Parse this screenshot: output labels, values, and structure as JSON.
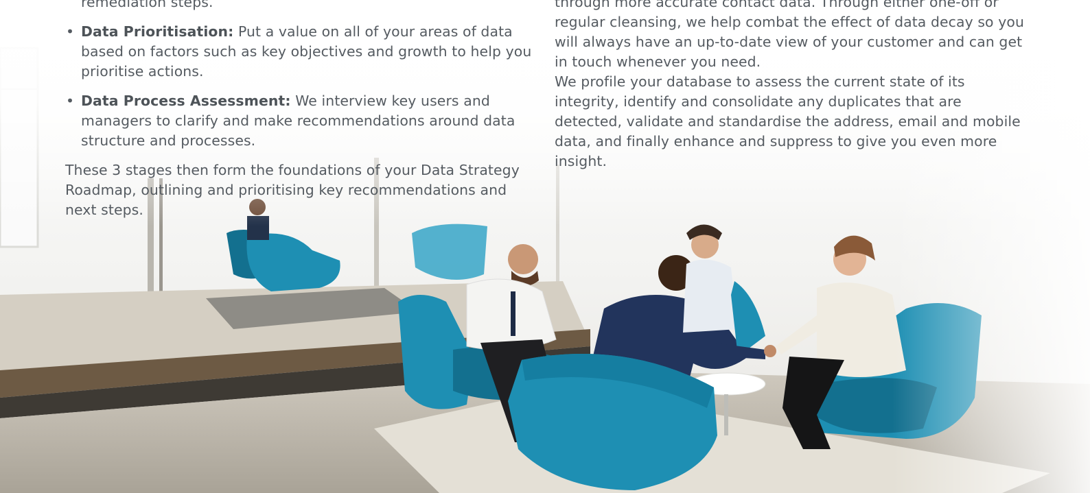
{
  "left_column": {
    "bullets": [
      {
        "term": "",
        "text": "remediation steps."
      },
      {
        "term": "Data Prioritisation:",
        "text": " Put a value on all of your areas of data based on factors such as key objectives and growth to help you prioritise actions."
      },
      {
        "term": "Data Process Assessment:",
        "text": " We interview key users and managers to clarify and make recommendations around data structure and processes."
      }
    ],
    "closing_paragraph": "These 3 stages then form the foundations of your Data Strategy Roadmap, outlining and prioritising key recommendations and next steps."
  },
  "right_column": {
    "paragraph_1": "through more accurate contact data. Through either one-off or regular cleansing, we help combat the effect of data decay so you will always have an up-to-date view of your customer and can get in touch whenever you need.",
    "paragraph_2": "We profile your database to assess the current state of its integrity, identify and consolidate any duplicates that are detected, validate and standardise the address, email and mobile data, and finally enhance and suppress to give you even more insight."
  },
  "photo": {
    "subject": "office-meeting-photo",
    "colors": {
      "chair": "#1e8fb3",
      "chair_dark": "#13708f",
      "floor": "#c9c3b8",
      "wall": "#f4f4f2",
      "wood": "#6d5a44"
    }
  }
}
